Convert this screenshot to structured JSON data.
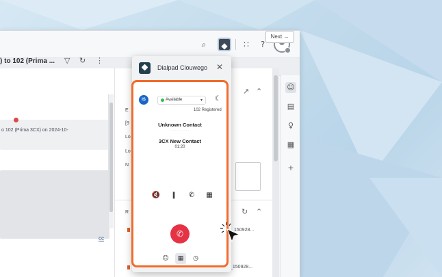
{
  "topbar": {
    "icons": [
      "search-icon",
      "extension-icon",
      "apps-grid-icon",
      "help-icon",
      "avatar-icon"
    ]
  },
  "subbar": {
    "next_label": "Next"
  },
  "record": {
    "title": ") to 102 (Prima ...",
    "note_text": "o 102 (Prima 3CX) on 2024-10-",
    "cc_label": "cc"
  },
  "mid": {
    "fragments": [
      "E",
      "[9",
      "Lo",
      "Lo",
      "N"
    ],
    "list_label": "R",
    "list_items": [
      "150928...",
      "_150928..."
    ]
  },
  "extension": {
    "title": "Dialpad Clouwego",
    "close": "✕"
  },
  "dialer": {
    "logo_text": "IS",
    "status": "Available",
    "registered": "102 Registered",
    "contact_name": "Unknown Contact",
    "contact_number": "· · · · · · · · ·",
    "second_contact": "3CX New Contact",
    "duration": "01:20"
  },
  "colors": {
    "accent_border": "#f26b2a",
    "hangup": "#e53345",
    "status_available": "#2fbf4a"
  }
}
